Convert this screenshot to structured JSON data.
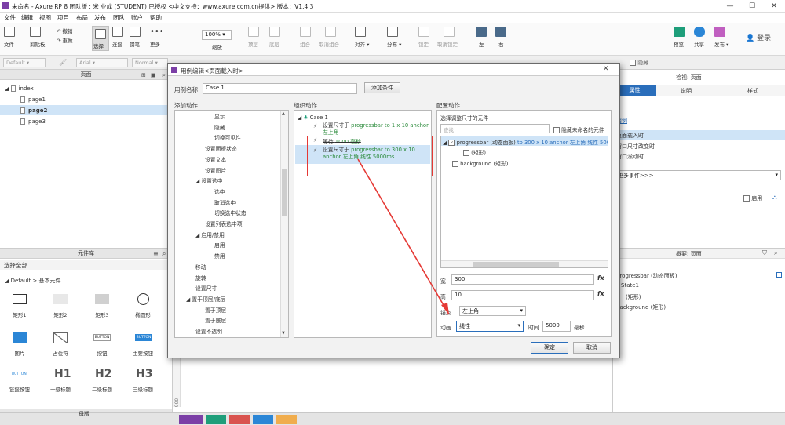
{
  "window": {
    "title": "未命名 - Axure RP 8 团队版 : 米 业成 (STUDENT) 已授权    <中文支持：www.axure.com.cn提供> 版本：V1.4.3",
    "controls": [
      "—",
      "☐",
      "✕"
    ]
  },
  "menubar": [
    "文件",
    "编辑",
    "视图",
    "项目",
    "布局",
    "发布",
    "团队",
    "账户",
    "帮助"
  ],
  "toolbar": {
    "file": "文件",
    "clipboard": "剪贴板",
    "undo": "撤销",
    "redo": "重做",
    "select": "选择",
    "connect": "连接",
    "pen": "钢笔",
    "more": "更多",
    "zoom_value": "100%",
    "zoom_label": "缩放",
    "top": "顶层",
    "bottom": "底层",
    "group": "组合",
    "ungroup": "取消组合",
    "align": "对齐",
    "distribute": "分布",
    "lock": "锁定",
    "unlock": "取消锁定",
    "left": "左",
    "right": "右",
    "preview": "预览",
    "share": "共享",
    "publish": "发布",
    "login": "登录"
  },
  "formatbar": {
    "style": "Default",
    "font": "Arial",
    "weight": "Normal",
    "hide_label": "隐藏"
  },
  "pages_panel": {
    "title": "页面",
    "items": [
      "index",
      "page1",
      "page2",
      "page3"
    ],
    "selected": "page2"
  },
  "library_panel": {
    "title": "元件库",
    "select_label": "选择全部",
    "category": "Default > 基本元件",
    "widgets": [
      "矩形1",
      "矩形2",
      "矩形3",
      "椭圆形",
      "图片",
      "占位符",
      "按钮",
      "主要按钮",
      "链接按钮",
      "一级标题",
      "二级标题",
      "三级标题"
    ],
    "button_text": "BUTTON",
    "h1": "H1",
    "h2": "H2",
    "h3": "H3"
  },
  "masters_panel": {
    "title": "母版"
  },
  "ruler_mark": "900",
  "right_panel": {
    "inspector_title": "检视: 页面",
    "tabs": [
      "属性",
      "说明",
      "样式"
    ],
    "case_link": "用例",
    "events": [
      "页面载入时",
      "窗口尺寸改变时",
      "窗口滚动时"
    ],
    "more_events": "更多事件>>>",
    "enable_label": "启用",
    "outline_title": "概要: 页面",
    "outline_items": [
      "progressbar (动态面板)",
      "State1",
      "(矩形)",
      "background (矩形)"
    ]
  },
  "dialog": {
    "title": "用例编辑<页面载入时>",
    "case_name_label": "用例名称",
    "case_name": "Case 1",
    "add_condition": "添加条件",
    "add_actions_title": "添加动作",
    "organize_actions_title": "组织动作",
    "configure_actions_title": "配置动作",
    "action_list": [
      {
        "label": "显示",
        "indent": 2
      },
      {
        "label": "隐藏",
        "indent": 2
      },
      {
        "label": "切换可见性",
        "indent": 2
      },
      {
        "label": "设置面板状态",
        "indent": 1
      },
      {
        "label": "设置文本",
        "indent": 1
      },
      {
        "label": "设置图片",
        "indent": 1
      },
      {
        "label": "设置选中",
        "indent": 1,
        "expander": true
      },
      {
        "label": "选中",
        "indent": 2
      },
      {
        "label": "取消选中",
        "indent": 2
      },
      {
        "label": "切换选中状态",
        "indent": 2
      },
      {
        "label": "设置列表选中项",
        "indent": 1
      },
      {
        "label": "启用/禁用",
        "indent": 1,
        "expander": true
      },
      {
        "label": "启用",
        "indent": 2
      },
      {
        "label": "禁用",
        "indent": 2
      },
      {
        "label": "移动",
        "indent": 0
      },
      {
        "label": "旋转",
        "indent": 0
      },
      {
        "label": "设置尺寸",
        "indent": 0
      },
      {
        "label": "置于顶层/底层",
        "indent": 0,
        "expander": true
      },
      {
        "label": "置于顶层",
        "indent": 1
      },
      {
        "label": "置于底层",
        "indent": 1
      },
      {
        "label": "设置不透明",
        "indent": 0
      }
    ],
    "case_label": "Case 1",
    "organized": [
      {
        "prefix": "设置尺寸于 ",
        "green": "progressbar to 1 x 10 anchor 左上角",
        "strike": false
      },
      {
        "prefix": "等待 ",
        "green": "1000 毫秒",
        "strike": true
      },
      {
        "prefix": "设置尺寸于 ",
        "green": "progressbar to 300 x 10 anchor 左上角 线性 5000ms",
        "strike": false
      }
    ],
    "select_widget_label": "选择调整尺寸的元件",
    "search_placeholder": "查找",
    "hide_unnamed": "隐藏未命名的元件",
    "widget_tree": [
      {
        "name": "progressbar (动态面板) ",
        "green": "to 300 x 10 anchor 左上角 线性 5000ms",
        "checked": true,
        "indent": 0
      },
      {
        "name": "(矩形)",
        "green": "",
        "checked": false,
        "indent": 1
      },
      {
        "name": "background (矩形)",
        "green": "",
        "checked": false,
        "indent": 0
      }
    ],
    "width_label": "宽",
    "width_value": "300",
    "height_label": "高",
    "height_value": "10",
    "fx": "fx",
    "anchor_label": "锚点",
    "anchor_value": "左上角",
    "animate_label": "动画",
    "animate_value": "线性",
    "time_label": "时间",
    "time_value": "5000",
    "ms_label": "毫秒",
    "ok": "确定",
    "cancel": "取消"
  },
  "colors": {
    "selection_blue": "#cfe4f7",
    "link_blue": "#2a6ebb",
    "highlight_red": "#e53935",
    "action_green": "#2a8a3a"
  }
}
